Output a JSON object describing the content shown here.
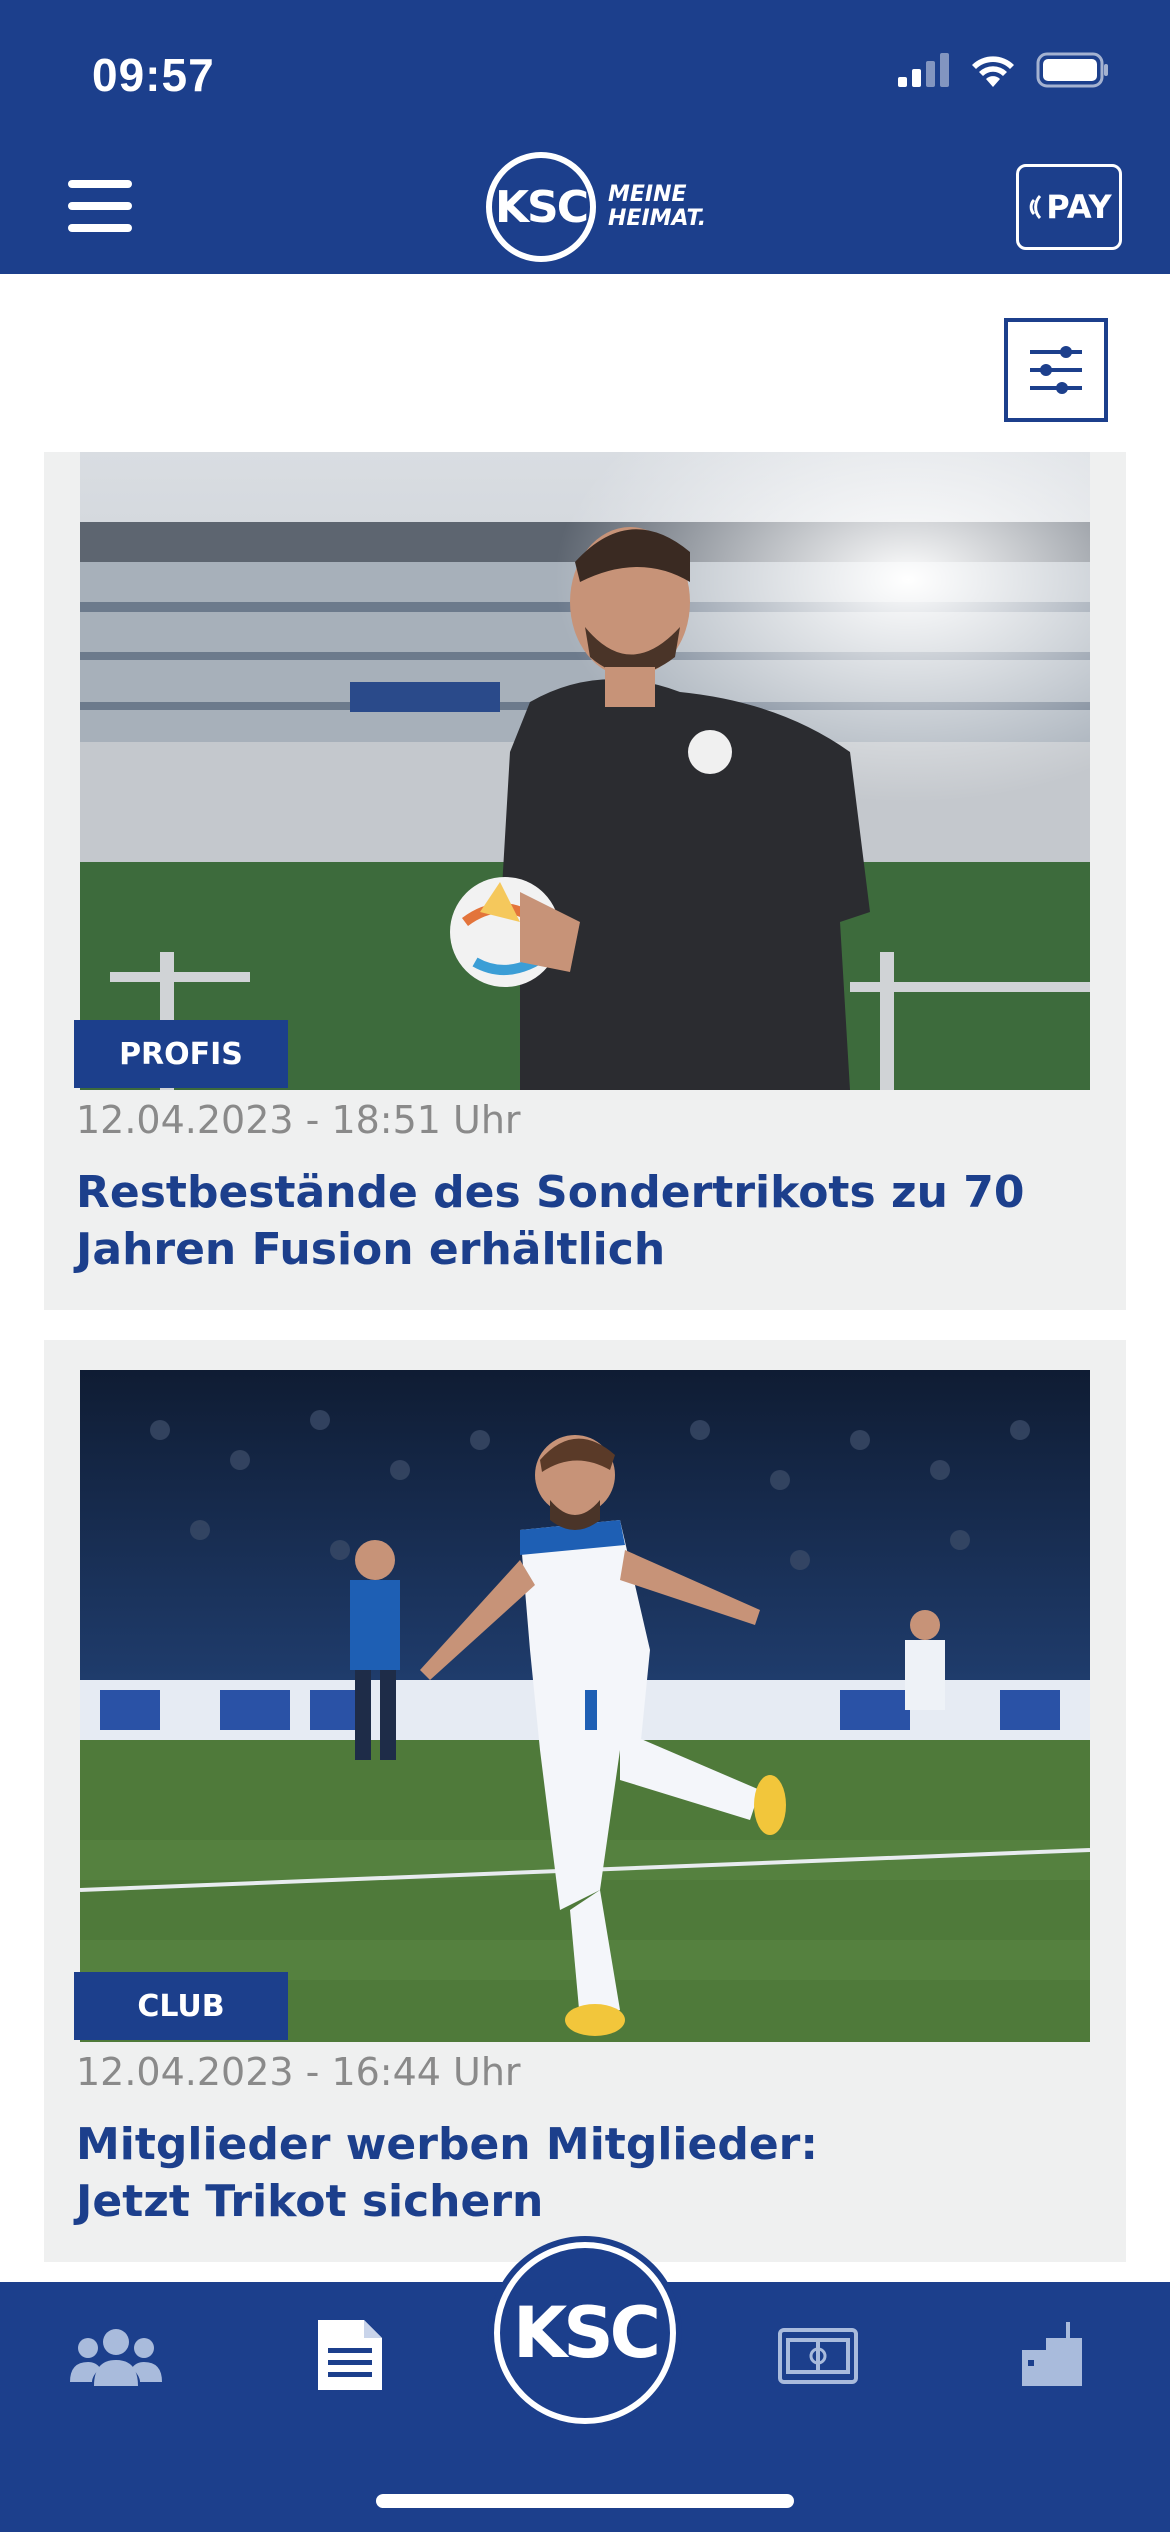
{
  "status": {
    "time": "09:57"
  },
  "header": {
    "logo_mark": "KSC",
    "logo_tagline_1": "MEINE",
    "logo_tagline_2": "HEIMAT.",
    "pay_label": "PAY"
  },
  "articles": [
    {
      "badge": "PROFIS",
      "date": "12.04.2023 - 18:51 Uhr",
      "title": "Restbestände des Sondertrikots zu 70 Jahren Fusion erhältlich"
    },
    {
      "badge": "CLUB",
      "date": "12.04.2023 - 16:44 Uhr",
      "title": "Mitglieder werben Mitglieder: Jetzt Trikot sichern"
    }
  ],
  "bottom_nav": {
    "center_label": "KSC",
    "items": [
      "team-icon",
      "news-icon",
      "ksc-home",
      "stadium-icon",
      "shop-icon"
    ]
  },
  "colors": {
    "brand_blue": "#1c3f8c",
    "card_bg": "#eff0f0",
    "date_gray": "#8a8a8a"
  }
}
